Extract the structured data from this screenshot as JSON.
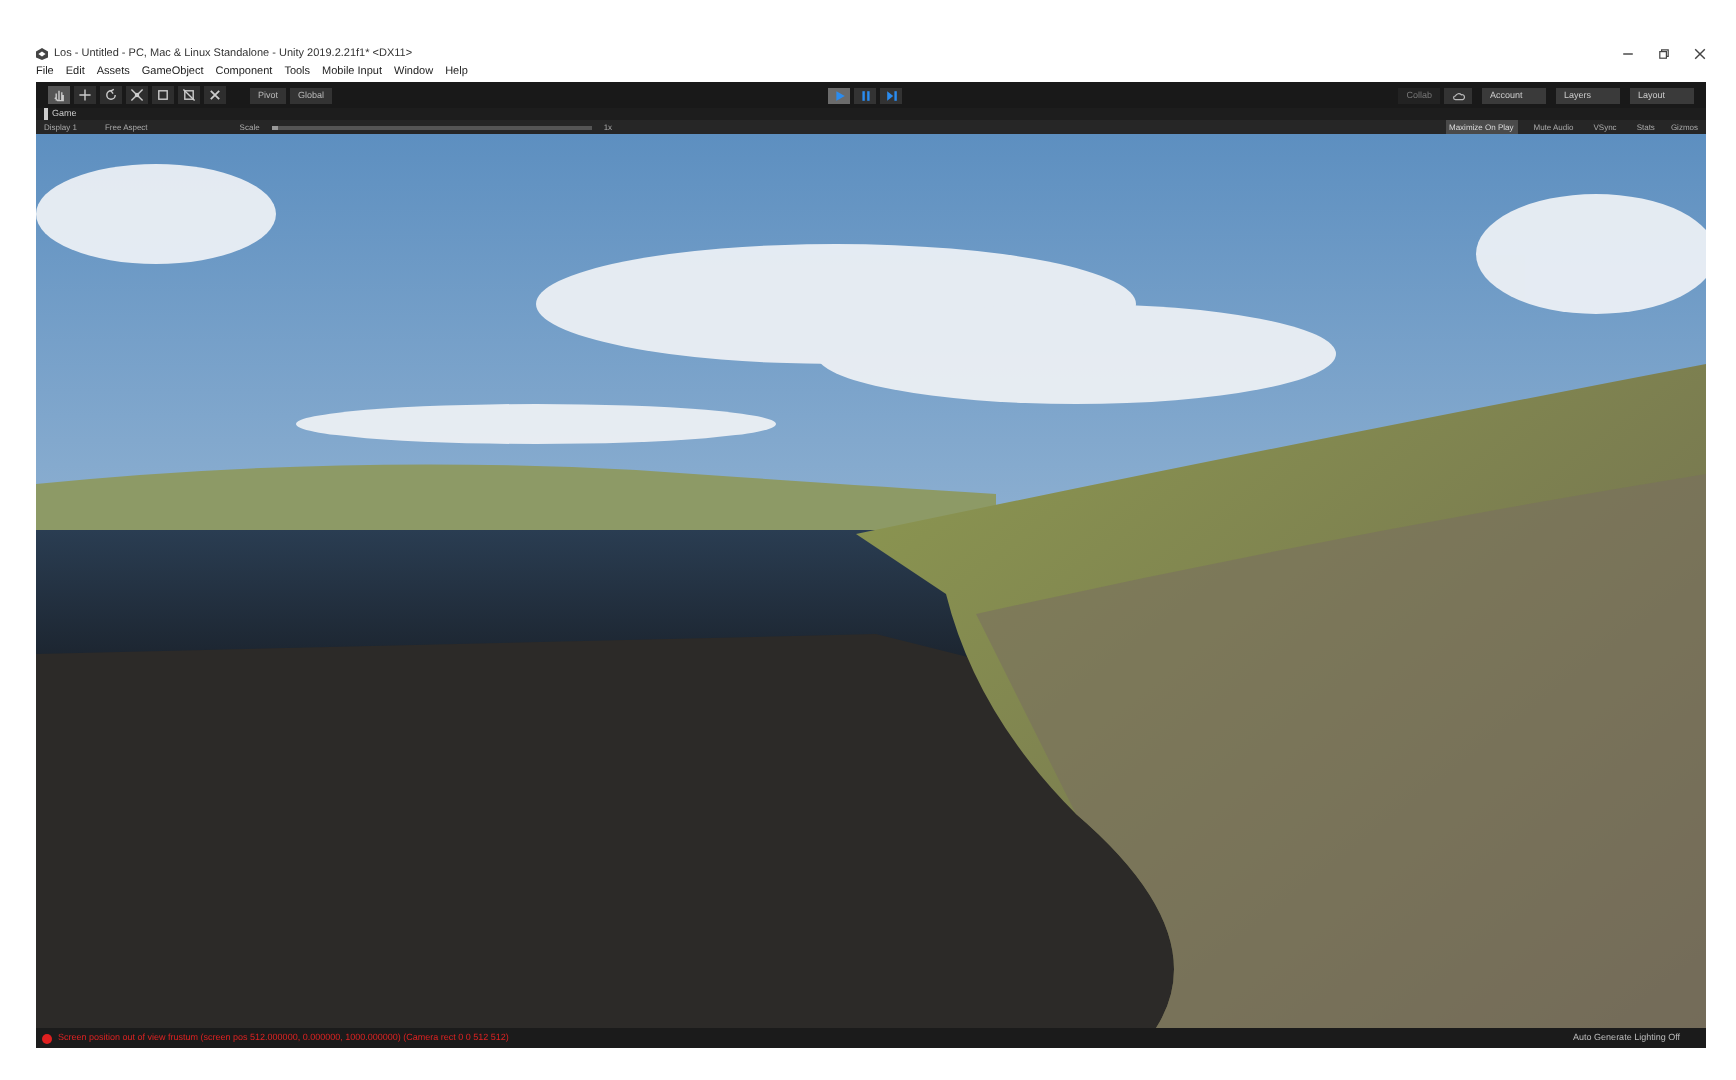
{
  "window": {
    "title": "Los - Untitled - PC, Mac & Linux Standalone - Unity 2019.2.21f1* <DX11>"
  },
  "menu": [
    "File",
    "Edit",
    "Assets",
    "GameObject",
    "Component",
    "Tools",
    "Mobile Input",
    "Window",
    "Help"
  ],
  "tools": [
    {
      "kind": "hand",
      "selected": true
    },
    {
      "kind": "move",
      "selected": false
    },
    {
      "kind": "rotate",
      "selected": false
    },
    {
      "kind": "scale",
      "selected": false
    },
    {
      "kind": "rect",
      "selected": false
    },
    {
      "kind": "transform",
      "selected": false
    },
    {
      "kind": "custom",
      "selected": false
    }
  ],
  "pivot_buttons": [
    "Pivot",
    "Global"
  ],
  "playback": [
    {
      "kind": "play",
      "selected": true
    },
    {
      "kind": "pause",
      "selected": false
    },
    {
      "kind": "step",
      "selected": false
    }
  ],
  "right_toolbar": {
    "collab": "Collab",
    "account": "Account",
    "layers": "Layers",
    "layout": "Layout"
  },
  "game_tab": {
    "label": "Game"
  },
  "game_toolbar": {
    "display": "Display 1",
    "aspect": "Free Aspect",
    "scale_label": "Scale",
    "scale_value": "1x",
    "level": 0.02,
    "toggles": [
      {
        "label": "Maximize On Play",
        "selected": true
      },
      {
        "label": "Mute Audio",
        "selected": false
      },
      {
        "label": "VSync",
        "selected": false
      },
      {
        "label": "Stats",
        "selected": false
      }
    ],
    "gizmos": "Gizmos"
  },
  "status_bar": {
    "message": "Screen position out of view frustum (screen pos 512.000000, 0.000000, 1000.000000) (Camera rect 0 0 512 512)",
    "lighting": "Auto Generate Lighting Off"
  }
}
